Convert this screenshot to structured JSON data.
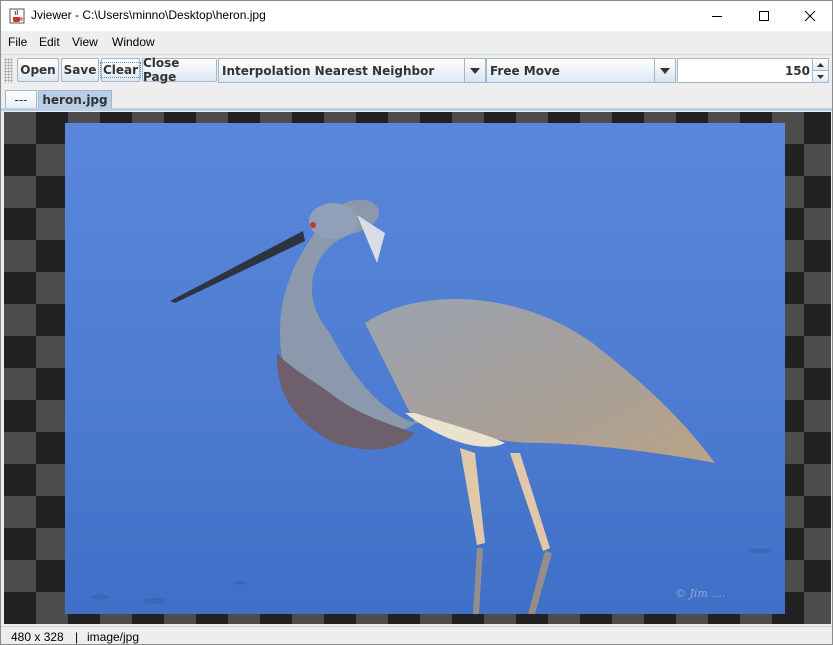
{
  "window": {
    "title": "Jviewer - C:\\Users\\minno\\Desktop\\heron.jpg",
    "app_icon": "java-cup-icon",
    "controls": [
      "minimize-icon",
      "maximize-icon",
      "close-icon"
    ]
  },
  "menu": {
    "items": [
      {
        "label": "File"
      },
      {
        "label": "Edit"
      },
      {
        "label": "View"
      },
      {
        "label": "Window"
      }
    ]
  },
  "toolbar": {
    "open_label": "Open",
    "save_label": "Save",
    "clear_label": "Clear",
    "close_page_label": "Close Page",
    "interpolation": {
      "selected": "Interpolation Nearest Neighbor"
    },
    "mode": {
      "selected": "Free Move"
    },
    "zoom_value": "150"
  },
  "tabs": [
    {
      "label": "---",
      "active": false
    },
    {
      "label": "heron.jpg",
      "active": true
    }
  ],
  "canvas": {
    "background": "checkerboard",
    "image_subject": "heron-photo",
    "watermark": "© Jim ...."
  },
  "status": {
    "dimensions": "480 x 328",
    "separator": "|",
    "mime_type": "image/jpg"
  },
  "colors": {
    "accent": "#b8cfe5",
    "button_border": "#a3b8cc",
    "checker_dark": "#222222",
    "checker_light": "#4d4d4d"
  }
}
